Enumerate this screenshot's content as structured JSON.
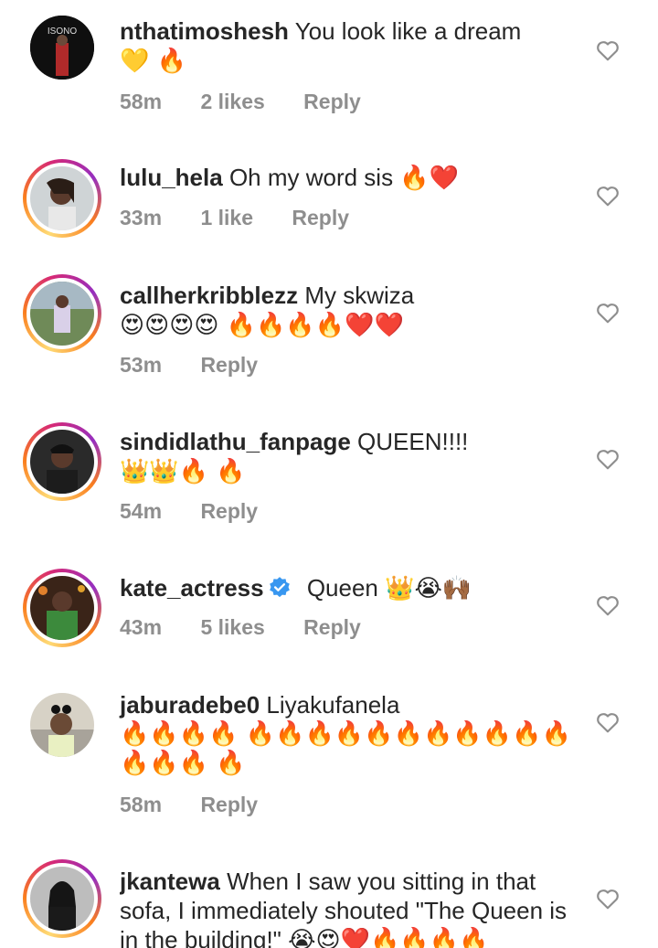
{
  "comments": [
    {
      "username": "nthatimoshesh",
      "text": "You look like a dream",
      "emoji": "💛 🔥",
      "time": "58m",
      "likes": "2 likes",
      "reply": "Reply",
      "avatar_label": "ISONO"
    },
    {
      "username": "lulu_hela",
      "text": "Oh my word sis",
      "emoji": "🔥❤️",
      "time": "33m",
      "likes": "1 like",
      "reply": "Reply"
    },
    {
      "username": "callherkribblezz",
      "text": "My skwiza",
      "emoji": "😍😍😍😍 🔥🔥🔥🔥❤️❤️",
      "time": "53m",
      "reply": "Reply"
    },
    {
      "username": "sindidlathu_fanpage",
      "text": "QUEEN!!!!",
      "emoji": "👑👑🔥 🔥",
      "time": "54m",
      "reply": "Reply"
    },
    {
      "username": "kate_actress",
      "text": "Queen",
      "emoji": "👑😭🙌🏾",
      "time": "43m",
      "likes": "5 likes",
      "reply": "Reply"
    },
    {
      "username": "jaburadebe0",
      "text": "Liyakufanela",
      "emoji": "🔥🔥🔥🔥 🔥🔥🔥🔥🔥🔥🔥🔥🔥🔥🔥🔥🔥🔥 🔥",
      "time": "58m",
      "reply": "Reply"
    },
    {
      "username": "jkantewa",
      "text": "When I saw you sitting in that sofa, I immediately shouted \"The Queen is in the building!\"",
      "emoji": "😭😍❤️🔥🔥🔥🔥",
      "time": "",
      "reply": ""
    }
  ],
  "colors": {
    "username": "#262626",
    "meta": "#8e8e8e",
    "heart_outline": "#8e8e8e",
    "verified": "#3897f0"
  },
  "icons": {
    "like": "heart-outline-icon",
    "verified": "verified-badge-icon"
  }
}
